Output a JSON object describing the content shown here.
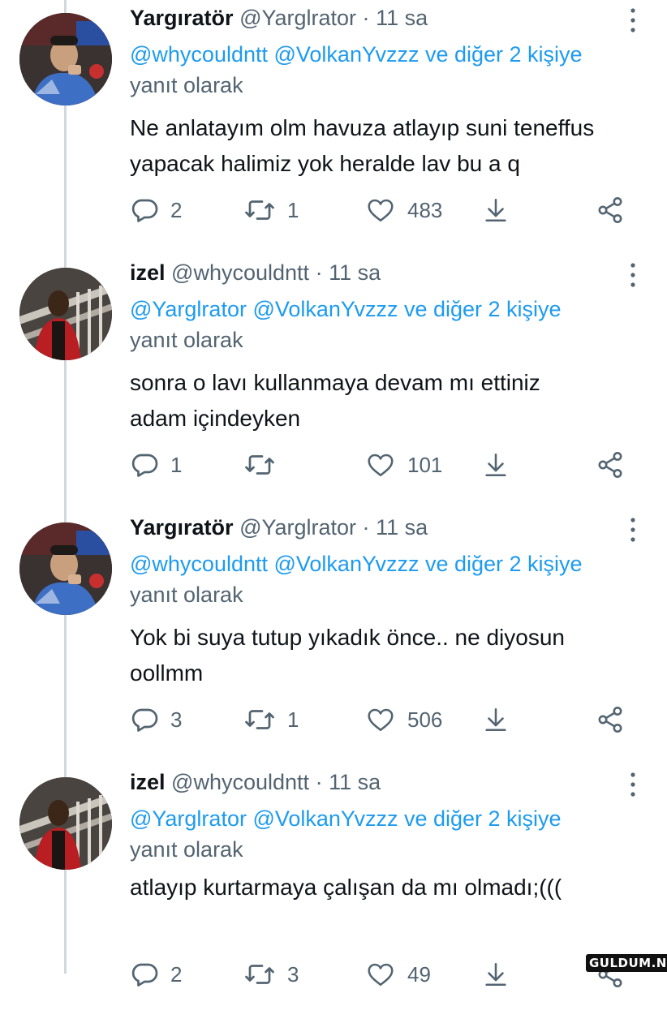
{
  "tweets": [
    {
      "name": "Yargıratör",
      "handle": "@Yarglrator",
      "dot": "·",
      "time": "11 sa",
      "mentions": "@whycouldntt @VolkanYvzzz ve diğer 2 kişiye",
      "reply_suffix": "yanıt olarak",
      "text": "Ne anlatayım olm havuza atlayıp suni teneffus\nyapacak halimiz yok heralde lav bu a q",
      "replies": "2",
      "retweets": "1",
      "likes": "483",
      "avatar": "avatar-yargirator"
    },
    {
      "name": "izel",
      "handle": "@whycouldntt",
      "dot": "·",
      "time": "11 sa",
      "mentions": "@Yarglrator @VolkanYvzzz ve diğer 2 kişiye",
      "reply_suffix": "yanıt olarak",
      "text": "sonra o lavı kullanmaya devam mı ettiniz\nadam içindeyken",
      "replies": "1",
      "retweets": "",
      "likes": "101",
      "avatar": "avatar-izel"
    },
    {
      "name": "Yargıratör",
      "handle": "@Yarglrator",
      "dot": "·",
      "time": "11 sa",
      "mentions": "@whycouldntt @VolkanYvzzz ve diğer 2 kişiye",
      "reply_suffix": "yanıt olarak",
      "text": "Yok bi suya tutup yıkadık önce.. ne diyosun\noollmm",
      "replies": "3",
      "retweets": "1",
      "likes": "506",
      "avatar": "avatar-yargirator"
    },
    {
      "name": "izel",
      "handle": "@whycouldntt",
      "dot": "·",
      "time": "11 sa",
      "mentions": "@Yarglrator @VolkanYvzzz ve diğer 2 kişiye",
      "reply_suffix": "yanıt olarak",
      "text": "atlayıp kurtarmaya çalışan da mı olmadı;(((",
      "replies": "2",
      "retweets": "3",
      "likes": "49",
      "avatar": "avatar-izel"
    }
  ],
  "icons": {
    "reply": "reply-icon",
    "retweet": "retweet-icon",
    "like": "heart-icon",
    "share": "share-icon",
    "download": "download-icon",
    "more": "more-icon"
  },
  "colors": {
    "link": "#1d9bf0",
    "secondary": "#536471",
    "thread_line": "#cfd9de"
  },
  "watermark": "GULDUM.NET"
}
